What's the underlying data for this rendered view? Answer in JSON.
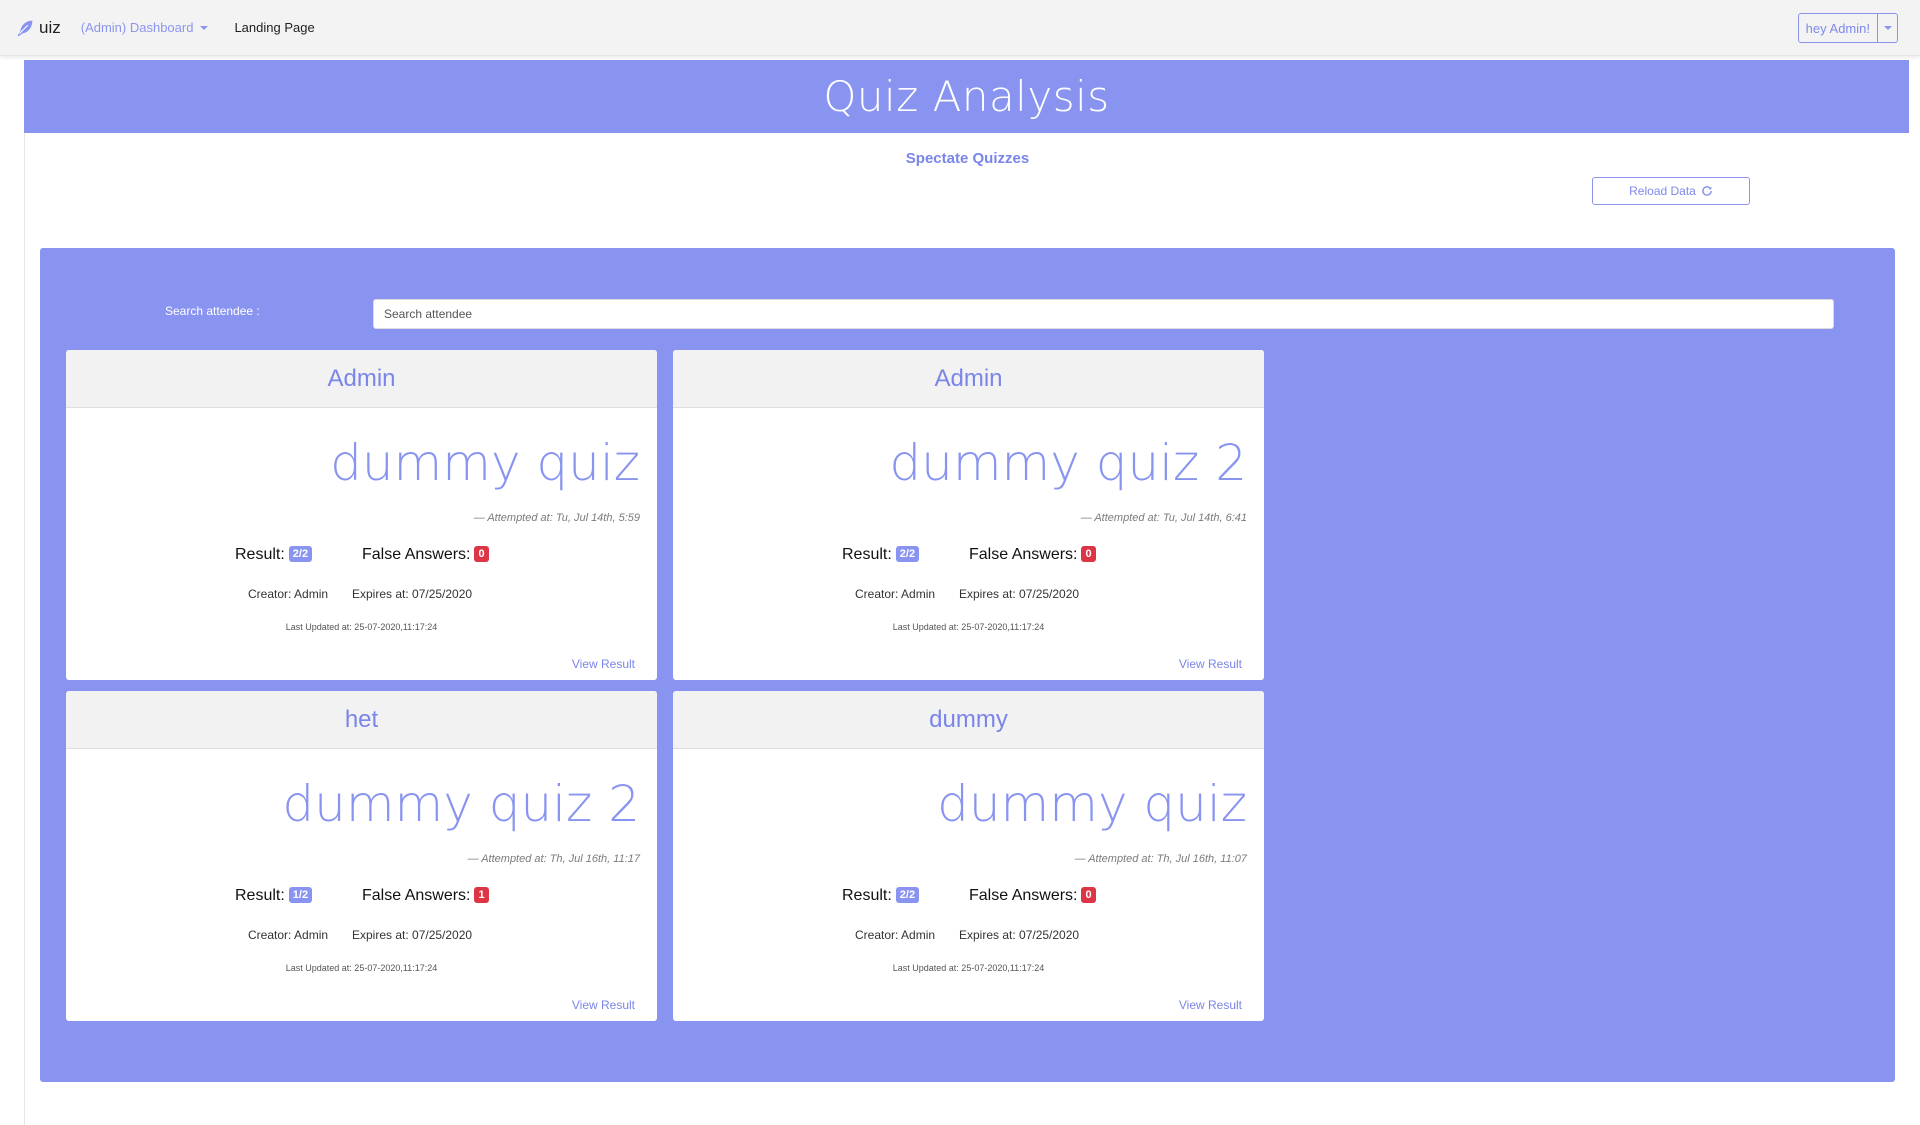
{
  "navbar": {
    "brand": "uiz",
    "brand_icon": "feather-icon",
    "dashboard_label": "(Admin) Dashboard",
    "landing_label": "Landing Page",
    "user_label": "hey Admin!"
  },
  "page": {
    "title": "Quiz Analysis",
    "spectate_label": "Spectate Quizzes",
    "reload_label": "Reload Data",
    "reload_icon": "refresh-icon"
  },
  "search": {
    "label": "Search attendee :",
    "placeholder": "Search attendee"
  },
  "colors": {
    "accent": "#8894ef",
    "danger": "#dc3545"
  },
  "cards": [
    {
      "attendee": "Admin",
      "quiz": "dummy quiz",
      "attempted": "— Attempted at: Tu, Jul 14th, 5:59",
      "result_label": "Result:",
      "result": "2/2",
      "false_label": "False Answers:",
      "false_answers": "0",
      "creator": "Creator: Admin",
      "expires": "Expires at: 07/25/2020",
      "updated": "Last Updated at: 25-07-2020,11:17:24",
      "view": "View Result"
    },
    {
      "attendee": "Admin",
      "quiz": "dummy quiz 2",
      "attempted": "— Attempted at: Tu, Jul 14th, 6:41",
      "result_label": "Result:",
      "result": "2/2",
      "false_label": "False Answers:",
      "false_answers": "0",
      "creator": "Creator: Admin",
      "expires": "Expires at: 07/25/2020",
      "updated": "Last Updated at: 25-07-2020,11:17:24",
      "view": "View Result"
    },
    {
      "attendee": "het",
      "quiz": "dummy quiz 2",
      "attempted": "— Attempted at: Th, Jul 16th, 11:17",
      "result_label": "Result:",
      "result": "1/2",
      "false_label": "False Answers:",
      "false_answers": "1",
      "creator": "Creator: Admin",
      "expires": "Expires at: 07/25/2020",
      "updated": "Last Updated at: 25-07-2020,11:17:24",
      "view": "View Result"
    },
    {
      "attendee": "dummy",
      "quiz": "dummy quiz",
      "attempted": "— Attempted at: Th, Jul 16th, 11:07",
      "result_label": "Result:",
      "result": "2/2",
      "false_label": "False Answers:",
      "false_answers": "0",
      "creator": "Creator: Admin",
      "expires": "Expires at: 07/25/2020",
      "updated": "Last Updated at: 25-07-2020,11:17:24",
      "view": "View Result"
    }
  ]
}
